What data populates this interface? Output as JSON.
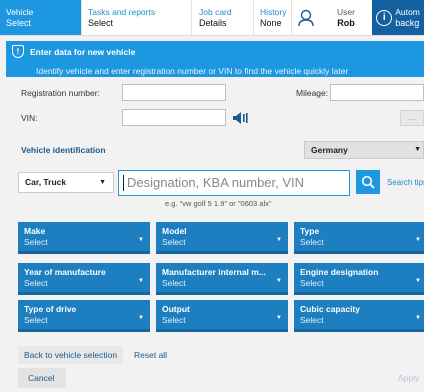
{
  "nav": {
    "vehicle": {
      "label": "Vehicle",
      "value": "Select"
    },
    "tasks": {
      "label": "Tasks and reports",
      "value": "Select"
    },
    "job_card": {
      "label": "Job card",
      "value": "Details"
    },
    "history": {
      "label": "History",
      "value": "None"
    },
    "user": {
      "label": "User",
      "value": "Rob"
    },
    "auto": {
      "line1": "Autom",
      "line2": "backg"
    }
  },
  "banner": {
    "title": "Enter data for new vehicle",
    "text": "Identify vehicle and enter registration number or VIN to find the vehicle quickly later"
  },
  "form": {
    "registration_label": "Registration number:",
    "mileage_label": "Mileage:",
    "vin_label": "VIN:",
    "dots_label": "..."
  },
  "identification": {
    "title": "Vehicle identification",
    "country": "Germany",
    "vehicle_type": "Car, Truck",
    "search_placeholder": "Designation, KBA number, VIN",
    "search_tips": "Search tips",
    "example": "e.g. \"vw golf 5 1.9\" or \"0603 alx\""
  },
  "filters": [
    {
      "label": "Make",
      "value": "Select"
    },
    {
      "label": "Model",
      "value": "Select"
    },
    {
      "label": "Type",
      "value": "Select"
    },
    {
      "label": "Year of manufacture",
      "value": "Select"
    },
    {
      "label": "Manufacturer internal m...",
      "value": "Select"
    },
    {
      "label": "Engine designation",
      "value": "Select"
    },
    {
      "label": "Type of drive",
      "value": "Select"
    },
    {
      "label": "Output",
      "value": "Select"
    },
    {
      "label": "Cubic capacity",
      "value": "Select"
    }
  ],
  "actions": {
    "back": "Back to vehicle selection",
    "reset": "Reset all",
    "cancel": "Cancel",
    "apply": "Apply"
  },
  "colors": {
    "accent": "#1d97e0",
    "filter_bg": "#1d7fc0",
    "auto_bg": "#1561a0"
  }
}
